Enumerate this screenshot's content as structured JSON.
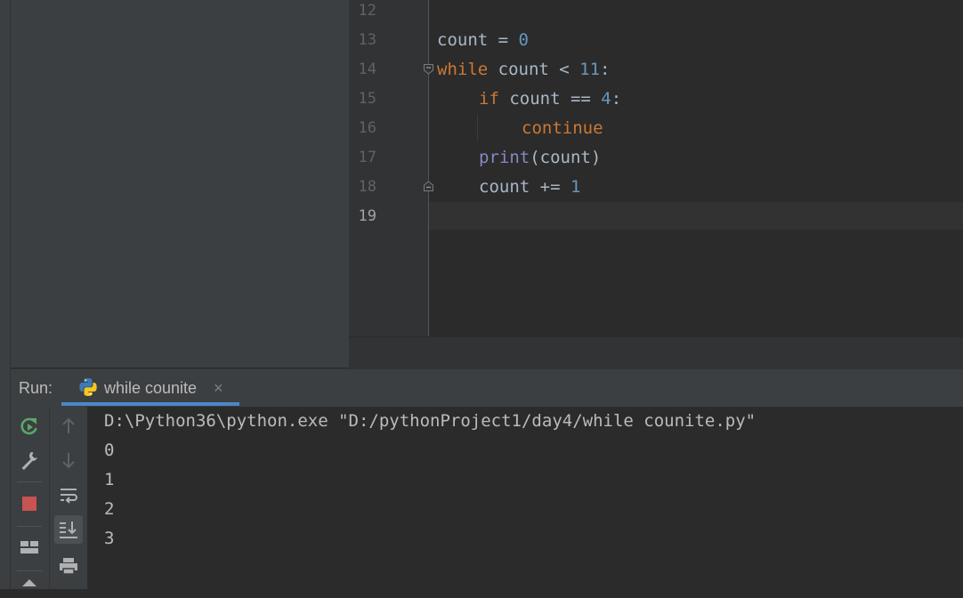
{
  "editor": {
    "line_numbers": [
      "12",
      "13",
      "14",
      "15",
      "16",
      "17",
      "18",
      "19"
    ],
    "active_line": "19",
    "code": {
      "l13_var": "count",
      "l13_op": " = ",
      "l13_num": "0",
      "l14_kw": "while",
      "l14_rest": " count < ",
      "l14_num": "11",
      "l14_colon": ":",
      "l15_kw": "if",
      "l15_rest": " count == ",
      "l15_num": "4",
      "l15_colon": ":",
      "l16_kw": "continue",
      "l17_fn": "print",
      "l17_rest": "(count)",
      "l18_rest": "count += ",
      "l18_num": "1"
    }
  },
  "run_panel": {
    "label": "Run:",
    "tab_label": "while counite",
    "tab_close": "×",
    "command": "D:\\Python36\\python.exe \"D:/pythonProject1/day4/while counite.py\"",
    "output": [
      "0",
      "1",
      "2",
      "3"
    ]
  },
  "icons": {
    "rerun": "rerun-icon",
    "settings": "wrench-icon",
    "stop": "stop-icon",
    "layout": "layout-icon",
    "up": "arrow-up-icon",
    "down": "arrow-down-icon",
    "soft_wrap": "soft-wrap-icon",
    "scroll_to_end": "scroll-to-end-icon",
    "print": "print-icon",
    "pin": "pin-icon"
  },
  "colors": {
    "keyword": "#cc7832",
    "number": "#6897bb",
    "builtin": "#8888c6",
    "text": "#a9b7c6",
    "stop": "#c75450",
    "rerun": "#59a869",
    "tab_underline": "#4a88c7"
  }
}
